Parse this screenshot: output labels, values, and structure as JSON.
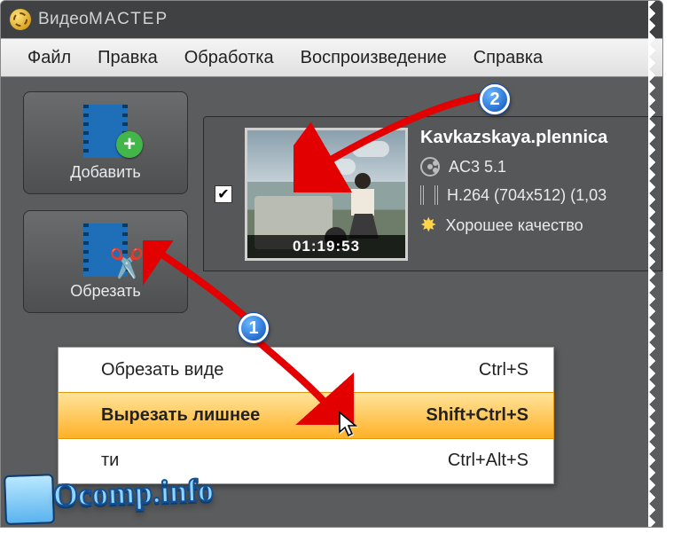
{
  "app": {
    "title_thin": "Видео",
    "title_wide": "МАСТЕР"
  },
  "menu": [
    "Файл",
    "Правка",
    "Обработка",
    "Воспроизведение",
    "Справка"
  ],
  "left_buttons": {
    "add": "Добавить",
    "crop": "Обрезать"
  },
  "video": {
    "duration": "01:19:53",
    "filename": "Kavkazskaya.plennica",
    "audio": "AC3 5.1",
    "codec": "H.264 (704x512) (1,03",
    "quality": "Хорошее качество",
    "checked": "✔"
  },
  "context_menu": {
    "items": [
      {
        "label": "Обрезать виде",
        "shortcut": "Ctrl+S"
      },
      {
        "label": "Вырезать лишнее",
        "shortcut": "Shift+Ctrl+S"
      },
      {
        "label": "ти",
        "shortcut": "Ctrl+Alt+S"
      }
    ]
  },
  "annotations": {
    "bubble1": "1",
    "bubble2": "2"
  },
  "watermark": "Ocomp.info"
}
